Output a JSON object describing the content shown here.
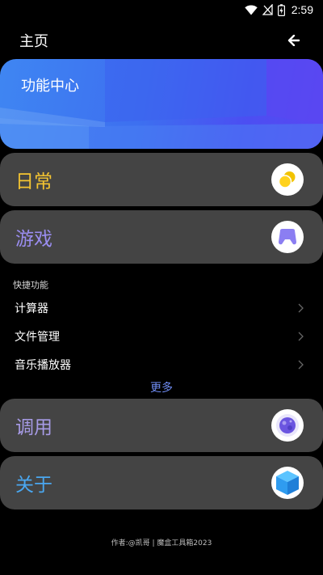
{
  "status_bar": {
    "time": "2:59",
    "icons": [
      "wifi-icon",
      "no-signal-icon",
      "battery-charging-icon"
    ]
  },
  "app_bar": {
    "title": "主页",
    "back_icon": "arrow-left-icon"
  },
  "banner": {
    "title": "功能中心"
  },
  "cards": [
    {
      "label": "日常",
      "color": "#f4c431",
      "icon": "daily-coins-icon"
    },
    {
      "label": "游戏",
      "color": "#9a8df0",
      "icon": "gamepad-icon"
    },
    {
      "label": "调用",
      "color": "#a79be6",
      "icon": "planet-icon"
    },
    {
      "label": "关于",
      "color": "#4aa7f0",
      "icon": "cube-icon"
    }
  ],
  "quick": {
    "section_label": "快捷功能",
    "items": [
      "计算器",
      "文件管理",
      "音乐播放器"
    ],
    "more_label": "更多",
    "more_color": "#6f8cf2"
  },
  "footer": {
    "text": "作者:@凯哥 | 魔盒工具箱2023"
  }
}
